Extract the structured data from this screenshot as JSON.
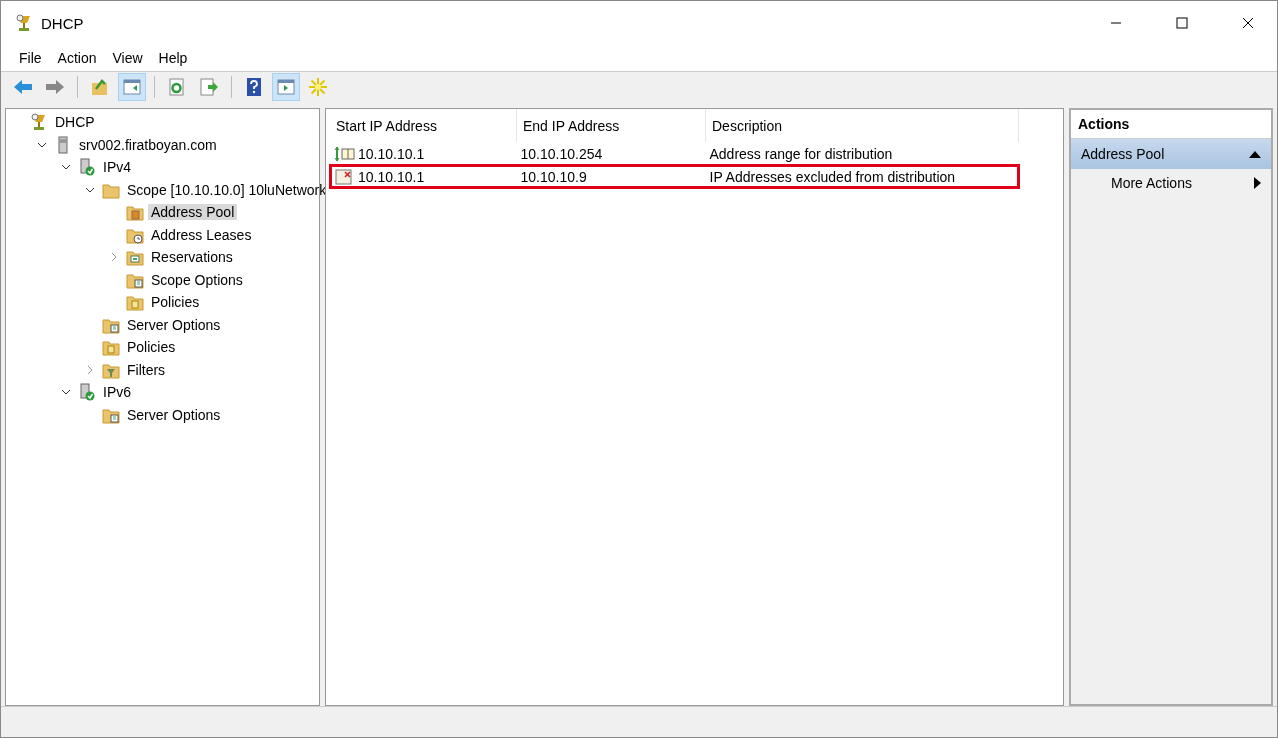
{
  "window": {
    "title": "DHCP"
  },
  "menu": [
    "File",
    "Action",
    "View",
    "Help"
  ],
  "toolbar": [
    [
      {
        "kind": "back",
        "selected": false
      },
      {
        "kind": "forward",
        "selected": false
      }
    ],
    [
      {
        "kind": "up",
        "selected": false
      },
      {
        "kind": "show-tree",
        "selected": true
      }
    ],
    [
      {
        "kind": "refresh",
        "selected": false
      },
      {
        "kind": "export",
        "selected": false
      }
    ],
    [
      {
        "kind": "help",
        "selected": false
      },
      {
        "kind": "show-actions",
        "selected": true
      },
      {
        "kind": "star",
        "selected": false
      }
    ]
  ],
  "tree": [
    {
      "label": "DHCP",
      "kind": "root",
      "selected": false,
      "children": [
        {
          "label": "srv002.firatboyan.com",
          "kind": "server",
          "selected": false,
          "expanded": true,
          "children": [
            {
              "label": "IPv4",
              "kind": "protocol",
              "selected": false,
              "expanded": true,
              "children": [
                {
                  "label": "Scope [10.10.10.0] 10luNetwork",
                  "kind": "scope",
                  "selected": false,
                  "expanded": true,
                  "children": [
                    {
                      "label": "Address Pool",
                      "kind": "pool",
                      "selected": true
                    },
                    {
                      "label": "Address Leases",
                      "kind": "leases",
                      "selected": false
                    },
                    {
                      "label": "Reservations",
                      "kind": "reservations",
                      "selected": false,
                      "expanded": false
                    },
                    {
                      "label": "Scope Options",
                      "kind": "options",
                      "selected": false
                    },
                    {
                      "label": "Policies",
                      "kind": "policies",
                      "selected": false
                    }
                  ]
                },
                {
                  "label": "Server Options",
                  "kind": "options",
                  "selected": false
                },
                {
                  "label": "Policies",
                  "kind": "policies",
                  "selected": false
                },
                {
                  "label": "Filters",
                  "kind": "filters",
                  "selected": false,
                  "expanded": false
                }
              ]
            },
            {
              "label": "IPv6",
              "kind": "protocol",
              "selected": false,
              "expanded": true,
              "children": [
                {
                  "label": "Server Options",
                  "kind": "options",
                  "selected": false
                }
              ]
            }
          ]
        }
      ]
    }
  ],
  "table": {
    "columns": [
      "Start IP Address",
      "End IP Address",
      "Description"
    ],
    "rows": [
      {
        "kind": "range",
        "highlighted": false,
        "cells": [
          "10.10.10.1",
          "10.10.10.254",
          "Address range for distribution"
        ]
      },
      {
        "kind": "exclusion",
        "highlighted": true,
        "cells": [
          "10.10.10.1",
          "10.10.10.9",
          "IP Addresses excluded from distribution"
        ]
      }
    ]
  },
  "actions": {
    "title": "Actions",
    "section": "Address Pool",
    "items": [
      "More Actions"
    ]
  }
}
